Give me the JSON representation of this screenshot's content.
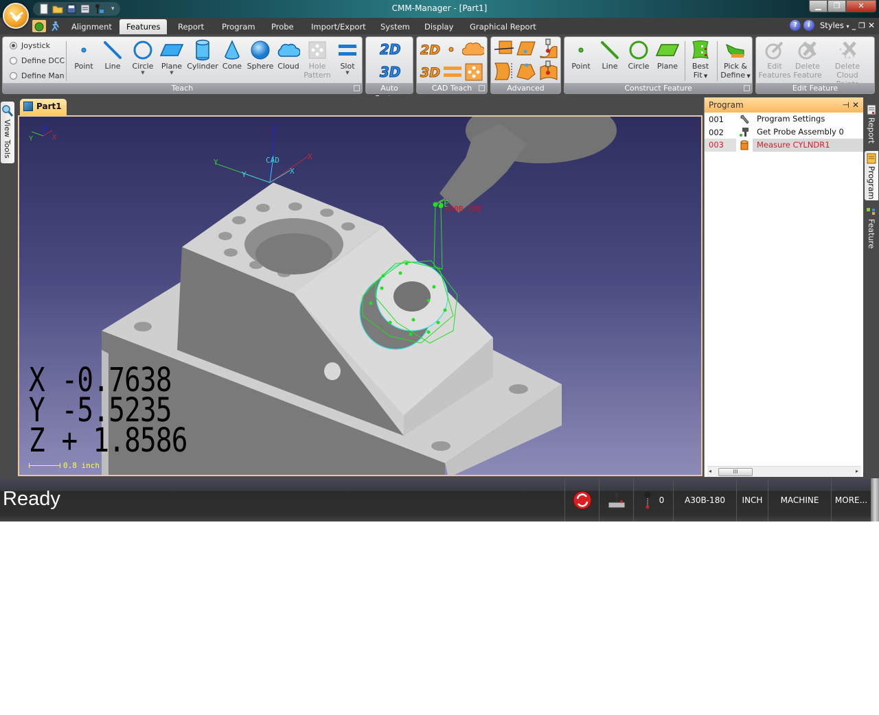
{
  "window": {
    "title": "CMM-Manager - [Part1]",
    "controls": [
      "minimize",
      "restore",
      "close"
    ]
  },
  "quick_access": {
    "icons": [
      "new-icon",
      "open-folder-icon",
      "save-icon",
      "print-preview-icon",
      "probe-key-icon"
    ],
    "more_label": "▾"
  },
  "menu_tabs": [
    {
      "label": "Alignment"
    },
    {
      "label": "Features",
      "active": true
    },
    {
      "label": "Report"
    },
    {
      "label": "Program"
    },
    {
      "label": "Probe"
    },
    {
      "label": "Import/Export"
    },
    {
      "label": "System"
    },
    {
      "label": "Display"
    },
    {
      "label": "Graphical Report"
    }
  ],
  "menu_right": {
    "help": "?",
    "info": "i",
    "styles_label": "Styles",
    "min": "_",
    "restore": "❐",
    "close": "✕"
  },
  "ribbon": {
    "mode_options": [
      {
        "label": "Joystick",
        "selected": true
      },
      {
        "label": "Define DCC",
        "selected": false
      },
      {
        "label": "Define Man",
        "selected": false
      }
    ],
    "teach": {
      "label": "Teach",
      "buttons": [
        {
          "label": "Point"
        },
        {
          "label": "Line"
        },
        {
          "label": "Circle",
          "dropdown": true
        },
        {
          "label": "Plane",
          "dropdown": true
        },
        {
          "label": "Cylinder"
        },
        {
          "label": "Cone"
        },
        {
          "label": "Sphere"
        },
        {
          "label": "Cloud"
        },
        {
          "label": "Hole Pattern",
          "line1": "Hole",
          "line2": "Pattern",
          "disabled": true
        },
        {
          "label": "Slot",
          "dropdown": true
        }
      ]
    },
    "auto_feature": {
      "label": "Auto Feature",
      "buttons": [
        "2D",
        "3D"
      ]
    },
    "cad_teach": {
      "label": "CAD Teach",
      "buttons": [
        "2D",
        "point",
        "cloud",
        "3D",
        "slot",
        "hole-pattern"
      ]
    },
    "advanced": {
      "label": "Advanced"
    },
    "construct": {
      "label": "Construct Feature",
      "buttons": [
        {
          "label": "Point"
        },
        {
          "label": "Line"
        },
        {
          "label": "Circle"
        },
        {
          "label": "Plane"
        },
        {
          "label": "Best Fit",
          "line1": "Best",
          "line2": "Fit",
          "dropdown": true
        },
        {
          "label": "Pick & Define",
          "line1": "Pick &",
          "line2": "Define",
          "dropdown": true
        }
      ]
    },
    "edit": {
      "label": "Edit Feature",
      "buttons": [
        {
          "line1": "Edit",
          "line2": "Features",
          "disabled": true
        },
        {
          "line1": "Delete",
          "line2": "Feature",
          "disabled": true
        },
        {
          "line1": "Delete Cloud",
          "line2": "Points",
          "disabled": true
        }
      ]
    }
  },
  "left_dock": {
    "view_tools_label": "View Tools"
  },
  "document": {
    "tab_label": "Part1",
    "viewport": {
      "triad_labels": {
        "x": "X",
        "y": "Y",
        "z": "Z"
      },
      "cad_label": "CAD",
      "probe_label": "A30B-180",
      "probe_tip_label": "SE",
      "dro": [
        {
          "axis": "X",
          "value": "-0.7638"
        },
        {
          "axis": "Y",
          "value": "-5.5235"
        },
        {
          "axis": "Z",
          "value": "+ 1.8586"
        }
      ],
      "scale_label": "0.8 inch"
    }
  },
  "program_panel": {
    "title": "Program",
    "pin": "⊣",
    "close": "✕",
    "rows": [
      {
        "num": "001",
        "icon": "wrench-icon",
        "label": "Program Settings",
        "selected": false
      },
      {
        "num": "002",
        "icon": "probe-assembly-icon",
        "label": "Get Probe Assembly 0",
        "selected": false
      },
      {
        "num": "003",
        "icon": "cylinder-icon",
        "label": "Measure CYLNDR1",
        "selected": true
      }
    ],
    "scroll_thumb": "III",
    "scroll_left": "◂",
    "scroll_right": "▸"
  },
  "right_dock": {
    "tabs": [
      {
        "label": "Report",
        "active": false
      },
      {
        "label": "Program",
        "active": true
      },
      {
        "label": "Feature",
        "active": false
      }
    ]
  },
  "status_bar": {
    "status": "Ready",
    "probe_count": "0",
    "probe_name": "A30B-180",
    "units": "INCH",
    "coord_system": "MACHINE",
    "more": "MORE..."
  },
  "colors": {
    "accent_orange": "#fbb860",
    "selected_row_text": "#d0202a",
    "viewport_top": "#2e2d5e",
    "viewport_bottom": "#8c8bb8",
    "measured_feature": "#20e020",
    "cad_outline": "#40e0e0"
  }
}
